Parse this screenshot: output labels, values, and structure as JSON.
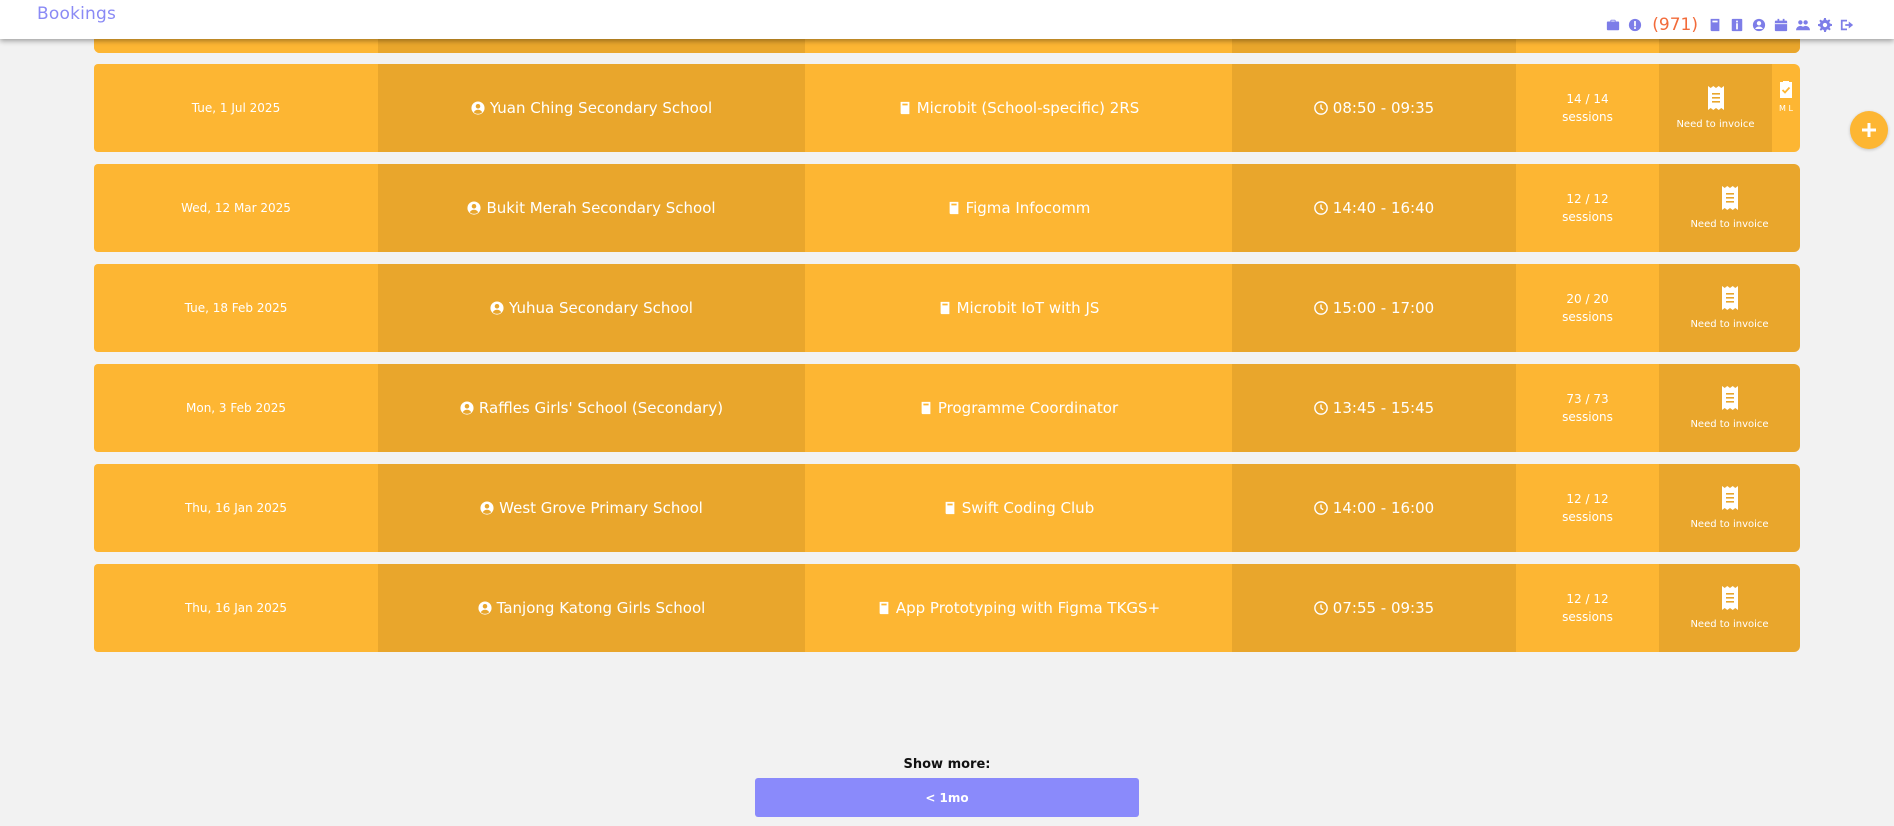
{
  "header": {
    "title": "Bookings",
    "notification_count": "(971)",
    "toolbar_icons": [
      "briefcase-icon",
      "alert-icon",
      "book-icon",
      "info-icon",
      "user-icon",
      "calendar-icon",
      "users-icon",
      "gear-icon",
      "logout-icon"
    ]
  },
  "colors": {
    "row_light": "#fdb633",
    "row_dark": "#e9a62c",
    "accent": "#8a8afb",
    "badge": "#f26b3a"
  },
  "bookings": [
    {
      "date": "Tue, 1 Jul 2025",
      "school": "Yuan Ching Secondary School",
      "course": "Microbit (School-specific) 2RS",
      "time": "08:50 - 09:35",
      "sessions_count": "14 / 14",
      "sessions_label": "sessions",
      "invoice_status": "Need to invoice",
      "side_tab_text": "M L"
    },
    {
      "date": "Wed, 12 Mar 2025",
      "school": "Bukit Merah Secondary School",
      "course": "Figma Infocomm",
      "time": "14:40 - 16:40",
      "sessions_count": "12 / 12",
      "sessions_label": "sessions",
      "invoice_status": "Need to invoice"
    },
    {
      "date": "Tue, 18 Feb 2025",
      "school": "Yuhua Secondary School",
      "course": "Microbit IoT with JS",
      "time": "15:00 - 17:00",
      "sessions_count": "20 / 20",
      "sessions_label": "sessions",
      "invoice_status": "Need to invoice"
    },
    {
      "date": "Mon, 3 Feb 2025",
      "school": "Raffles Girls' School (Secondary)",
      "course": "Programme Coordinator",
      "time": "13:45 - 15:45",
      "sessions_count": "73 / 73",
      "sessions_label": "sessions",
      "invoice_status": "Need to invoice"
    },
    {
      "date": "Thu, 16 Jan 2025",
      "school": "West Grove Primary School",
      "course": "Swift Coding Club",
      "time": "14:00 - 16:00",
      "sessions_count": "12 / 12",
      "sessions_label": "sessions",
      "invoice_status": "Need to invoice"
    },
    {
      "date": "Thu, 16 Jan 2025",
      "school": "Tanjong Katong Girls School",
      "course": "App Prototyping with Figma TKGS+",
      "time": "07:55 - 09:35",
      "sessions_count": "12 / 12",
      "sessions_label": "sessions",
      "invoice_status": "Need to invoice"
    }
  ],
  "show_more": {
    "label": "Show more:",
    "button": "< 1mo"
  }
}
